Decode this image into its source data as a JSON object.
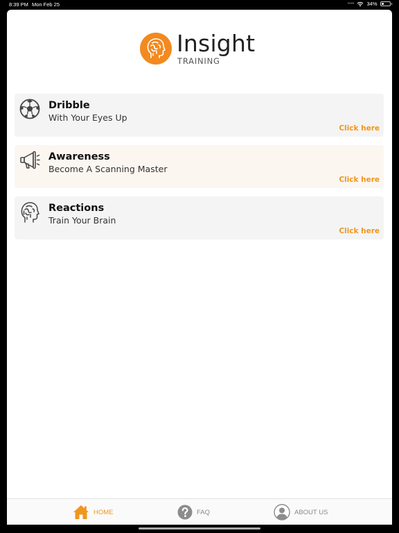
{
  "status_bar": {
    "time": "8:39 PM",
    "date": "Mon Feb 25",
    "battery": "34%",
    "battery_level": 0.34
  },
  "logo": {
    "word": "Insight",
    "subtitle": "TRAINING",
    "icon": "head-brain-icon",
    "brand_color": "#f28a1f"
  },
  "cards": [
    {
      "title": "Dribble",
      "subtitle": "With Your Eyes Up",
      "link": "Click here",
      "icon": "soccer-ball-icon"
    },
    {
      "title": "Awareness",
      "subtitle": "Become A Scanning Master",
      "link": "Click here",
      "icon": "megaphone-icon"
    },
    {
      "title": "Reactions",
      "subtitle": "Train Your Brain",
      "link": "Click here",
      "icon": "head-brain-icon"
    }
  ],
  "tabbar": {
    "home": "HOME",
    "faq": "FAQ",
    "about": "ABOUT US",
    "active": "home",
    "active_color": "#f0961e"
  }
}
